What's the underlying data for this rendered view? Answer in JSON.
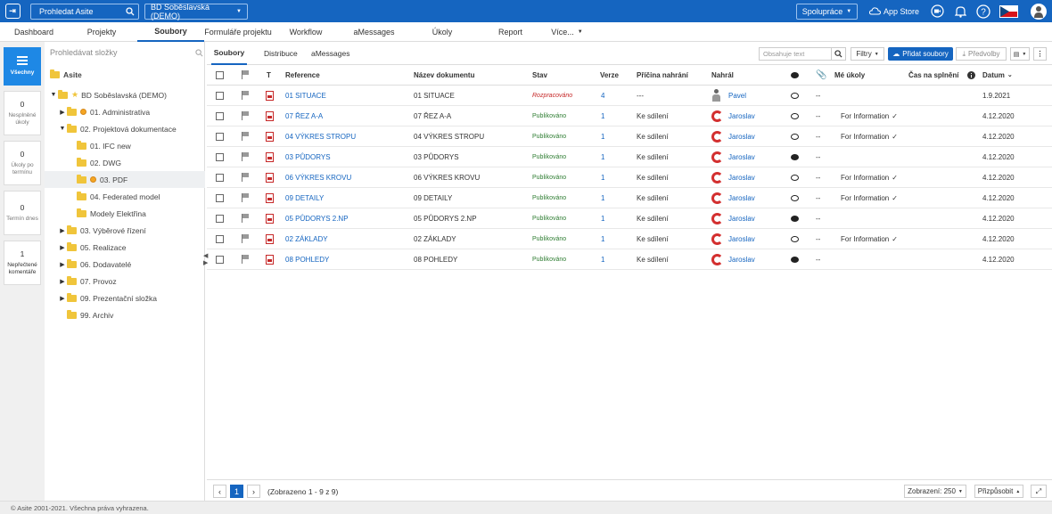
{
  "topbar": {
    "search_label": "Prohledat Asite",
    "project_select": "BD Soběslavská (DEMO)",
    "collab_label": "Spolupráce",
    "appstore_label": "App Store"
  },
  "nav": {
    "items": [
      "Dashboard",
      "Projekty",
      "Soubory",
      "Formuláře projektu",
      "Workflow",
      "aMessages",
      "Úkoly",
      "Report",
      "Více..."
    ]
  },
  "rail": {
    "all_label": "Všechny",
    "cards": [
      {
        "num": "0",
        "label": "Nesplněné úkoly"
      },
      {
        "num": "0",
        "label": "Úkoly po termínu"
      },
      {
        "num": "0",
        "label": "Termín dnes"
      },
      {
        "num": "1",
        "label": "Nepřečtené komentáře"
      }
    ]
  },
  "tree": {
    "search_placeholder": "Prohledávat složky",
    "items": [
      {
        "label": "Asite",
        "bold": true
      },
      {
        "label": "BD Soběslavská (DEMO)"
      },
      {
        "label": "01. Administrativa"
      },
      {
        "label": "02. Projektová dokumentace"
      },
      {
        "label": "01. IFC new"
      },
      {
        "label": "02. DWG"
      },
      {
        "label": "03. PDF"
      },
      {
        "label": "04. Federated model"
      },
      {
        "label": "Modely Elektřina"
      },
      {
        "label": "03. Výběrové řízení"
      },
      {
        "label": "05. Realizace"
      },
      {
        "label": "06. Dodavatelé"
      },
      {
        "label": "07. Provoz"
      },
      {
        "label": "09. Prezentační složka"
      },
      {
        "label": "99. Archiv"
      }
    ]
  },
  "subtabs": [
    "Soubory",
    "Distribuce",
    "aMessages"
  ],
  "toolbar": {
    "filter_placeholder": "Obsahuje text",
    "filters_label": "Filtry",
    "add_label": "Přidat soubory",
    "preferences_label": "Předvolby"
  },
  "table": {
    "headers": {
      "t": "T",
      "reference": "Reference",
      "name": "Název dokumentu",
      "status": "Stav",
      "version": "Verze",
      "reason": "Příčina nahrání",
      "uploader": "Nahrál",
      "tasks": "Mé úkoly",
      "due": "Čas na splnění",
      "date": "Datum"
    },
    "rows": [
      {
        "ref": "01 SITUACE",
        "name": "01 SITUACE",
        "status": "Rozpracováno",
        "ver": "4",
        "reason": "---",
        "user": "Pavel",
        "comments": "--",
        "task": "",
        "date": "1.9.2021"
      },
      {
        "ref": "07 ŘEZ A-A",
        "name": "07 ŘEZ A-A",
        "status": "Publikováno",
        "ver": "1",
        "reason": "Ke sdílení",
        "user": "Jaroslav",
        "comments": "--",
        "task": "For Information",
        "date": "4.12.2020"
      },
      {
        "ref": "04 VÝKRES STROPU",
        "name": "04 VÝKRES STROPU",
        "status": "Publikováno",
        "ver": "1",
        "reason": "Ke sdílení",
        "user": "Jaroslav",
        "comments": "--",
        "task": "For Information",
        "date": "4.12.2020"
      },
      {
        "ref": "03 PŮDORYS",
        "name": "03 PŮDORYS",
        "status": "Publikováno",
        "ver": "1",
        "reason": "Ke sdílení",
        "user": "Jaroslav",
        "comments": "--",
        "task": "",
        "date": "4.12.2020"
      },
      {
        "ref": "06 VÝKRES KROVU",
        "name": "06 VÝKRES KROVU",
        "status": "Publikováno",
        "ver": "1",
        "reason": "Ke sdílení",
        "user": "Jaroslav",
        "comments": "--",
        "task": "For Information",
        "date": "4.12.2020"
      },
      {
        "ref": "09 DETAILY",
        "name": "09 DETAILY",
        "status": "Publikováno",
        "ver": "1",
        "reason": "Ke sdílení",
        "user": "Jaroslav",
        "comments": "--",
        "task": "For Information",
        "date": "4.12.2020"
      },
      {
        "ref": "05 PŮDORYS 2.NP",
        "name": "05 PŮDORYS 2.NP",
        "status": "Publikováno",
        "ver": "1",
        "reason": "Ke sdílení",
        "user": "Jaroslav",
        "comments": "--",
        "task": "",
        "date": "4.12.2020"
      },
      {
        "ref": "02 ZÁKLADY",
        "name": "02 ZÁKLADY",
        "status": "Publikováno",
        "ver": "1",
        "reason": "Ke sdílení",
        "user": "Jaroslav",
        "comments": "--",
        "task": "For Information",
        "date": "4.12.2020"
      },
      {
        "ref": "08 POHLEDY",
        "name": "08 POHLEDY",
        "status": "Publikováno",
        "ver": "1",
        "reason": "Ke sdílení",
        "user": "Jaroslav",
        "comments": "--",
        "task": "",
        "date": "4.12.2020"
      }
    ]
  },
  "pager": {
    "page": "1",
    "info": "(Zobrazeno 1 - 9 z 9)",
    "display_label": "Zobrazení: 250",
    "customize_label": "Přizpůsobit"
  },
  "footer": {
    "copyright": "© Asite 2001-2021. Všechna práva vyhrazena."
  },
  "colors": {
    "brand": "#1565c0",
    "published": "#2e7d32",
    "draft": "#c62828"
  }
}
